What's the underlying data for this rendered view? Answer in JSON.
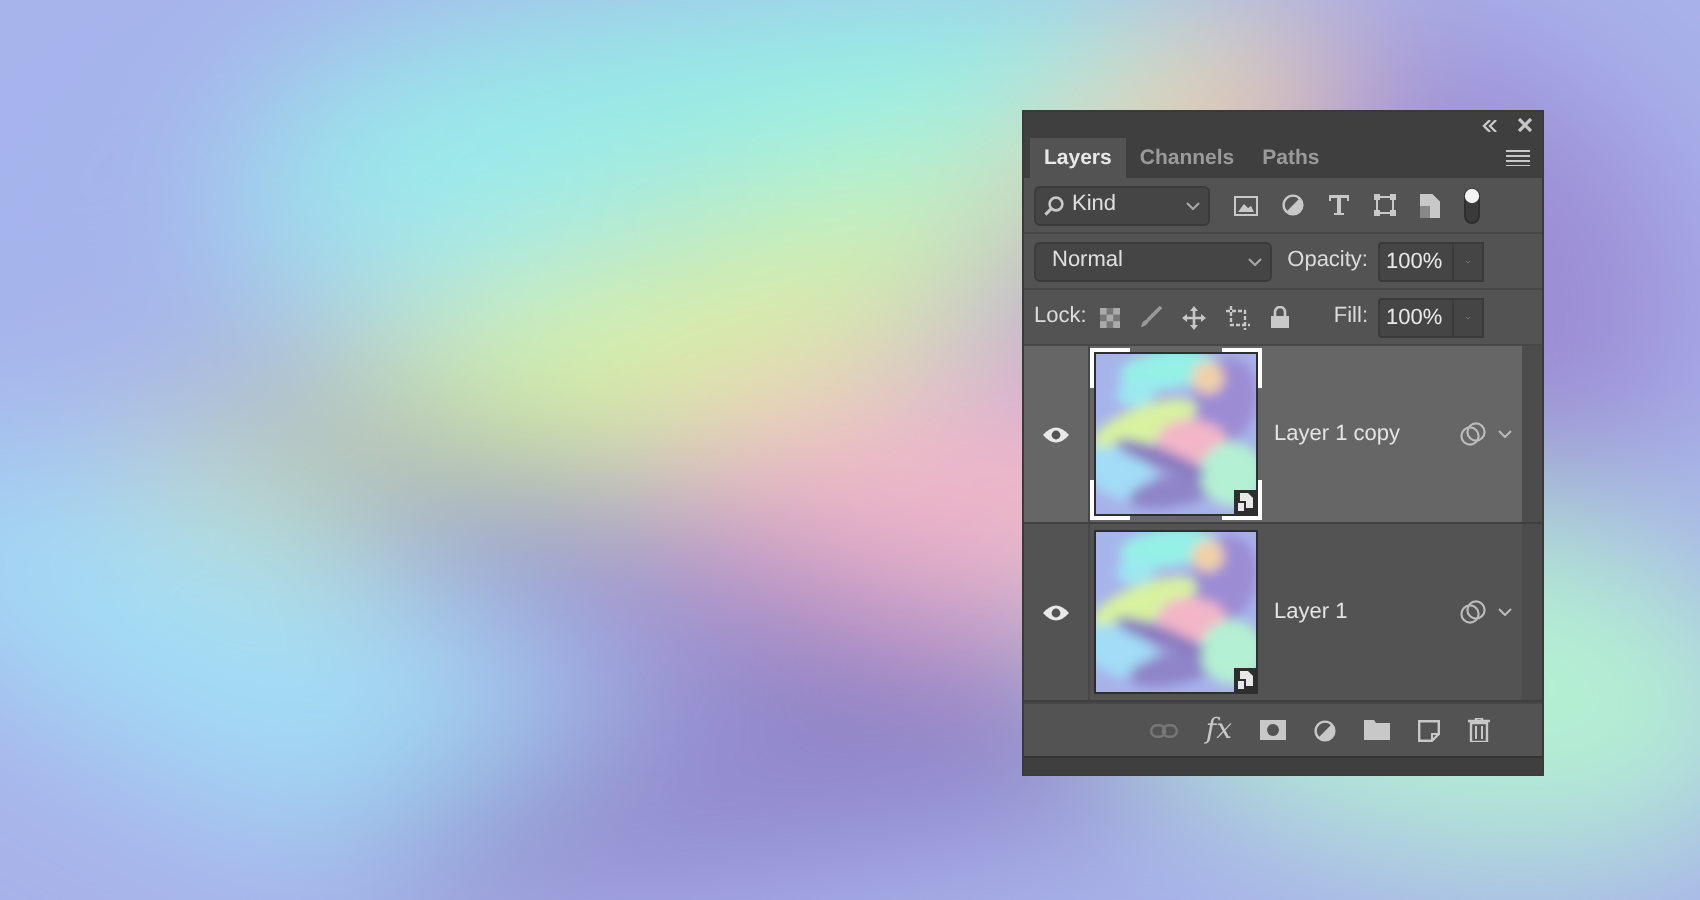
{
  "panel": {
    "tabs": [
      {
        "label": "Layers",
        "selected": true
      },
      {
        "label": "Channels",
        "selected": false
      },
      {
        "label": "Paths",
        "selected": false
      }
    ],
    "filter": {
      "value": "Kind",
      "switch_on": true
    },
    "blend_mode": "Normal",
    "opacity": {
      "label": "Opacity:",
      "value": "100%"
    },
    "lock": {
      "label": "Lock:"
    },
    "fill": {
      "label": "Fill:",
      "value": "100%"
    },
    "layers": [
      {
        "name": "Layer 1 copy",
        "visible": true,
        "selected": true
      },
      {
        "name": "Layer 1",
        "visible": true,
        "selected": false
      }
    ],
    "footer": {
      "effects_label": "fx"
    }
  }
}
